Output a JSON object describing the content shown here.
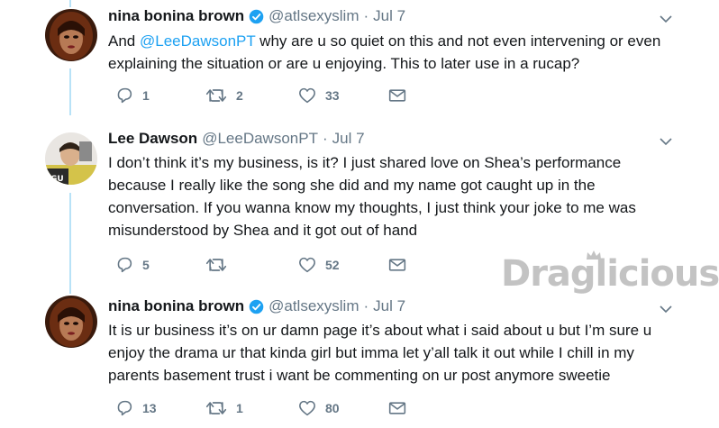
{
  "tweets": [
    {
      "name": "nina bonina brown",
      "verified": true,
      "handle": "@atlsexyslim",
      "time": "Jul 7",
      "text_before": "And ",
      "mention": "@LeeDawsonPT",
      "text_after": " why are u so quiet on this and not even intervening or even explaining the situation or are u enjoying. This to later use in a rucap?",
      "replies": "1",
      "retweets": "2",
      "likes": "33"
    },
    {
      "name": "Lee Dawson",
      "verified": false,
      "handle": "@LeeDawsonPT",
      "time": "Jul 7",
      "text": "I don’t think it’s my business, is it? I just shared love on Shea’s performance because I really like the song she did and my name got caught up in the conversation. If you wanna know my thoughts, I just think your joke to me was misunderstood by Shea and it got out of hand",
      "replies": "5",
      "retweets": "",
      "likes": "52"
    },
    {
      "name": "nina bonina brown",
      "verified": true,
      "handle": "@atlsexyslim",
      "time": "Jul 7",
      "text": "It is ur business it’s on ur damn page it’s about what i said about u but I’m sure u enjoy the drama ur that kinda girl but imma let y’all talk it out while I chill in my parents basement trust i want be commenting on ur post anymore sweetie",
      "replies": "13",
      "retweets": "1",
      "likes": "80"
    }
  ],
  "watermark": {
    "text": "Draglicious"
  },
  "colors": {
    "accent": "#1da1f2",
    "muted": "#657786",
    "thread": "#b8e2f7"
  },
  "icons": [
    "reply-icon",
    "retweet-icon",
    "like-icon",
    "message-icon",
    "verified-badge-icon",
    "chevron-down-icon"
  ]
}
